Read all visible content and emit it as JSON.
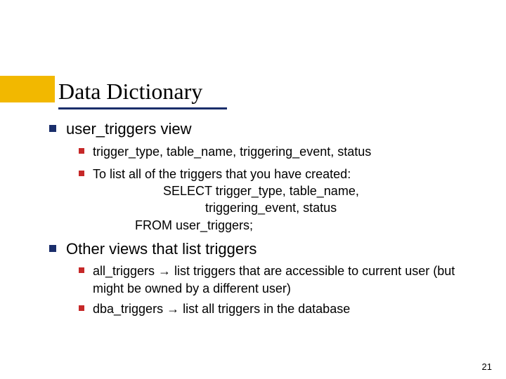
{
  "title": "Data Dictionary",
  "sections": [
    {
      "heading": "user_triggers view",
      "items": [
        {
          "text": "trigger_type, table_name, triggering_event, status"
        },
        {
          "text": "To list all of the triggers that you have created:",
          "code": [
            "SELECT trigger_type, table_name,",
            "triggering_event, status",
            "FROM user_triggers;"
          ]
        }
      ]
    },
    {
      "heading": "Other views that list triggers",
      "items": [
        {
          "text_pre": "all_triggers ",
          "arrow": "→",
          "text_post": " list triggers that are accessible to current user (but might be owned by a different user)"
        },
        {
          "text_pre": "dba_triggers ",
          "arrow": "→",
          "text_post": " list all triggers in the database"
        }
      ]
    }
  ],
  "page_number": "21"
}
